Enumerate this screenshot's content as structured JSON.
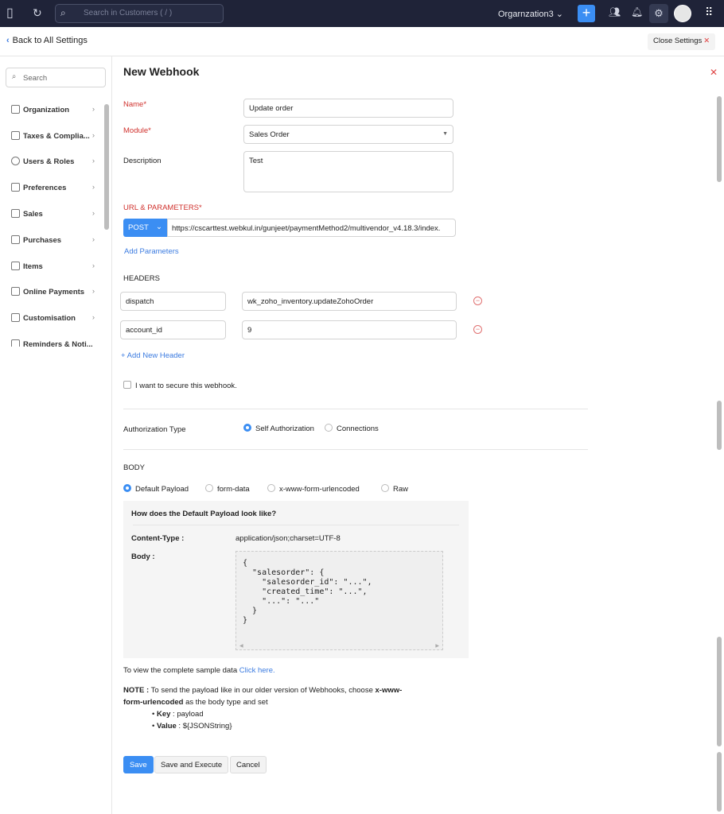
{
  "topbar": {
    "search_placeholder": "Search in Customers ( / )",
    "org": "Orgarnzation3"
  },
  "subheader": {
    "back": "Back to All Settings",
    "close": "Close Settings"
  },
  "sidebar": {
    "search_placeholder": "Search",
    "items": [
      {
        "label": "Organization"
      },
      {
        "label": "Taxes & Complia..."
      },
      {
        "label": "Users & Roles"
      },
      {
        "label": "Preferences"
      },
      {
        "label": "Sales"
      },
      {
        "label": "Purchases"
      },
      {
        "label": "Items"
      },
      {
        "label": "Online Payments"
      },
      {
        "label": "Customisation"
      },
      {
        "label": "Reminders & Noti..."
      }
    ]
  },
  "form": {
    "title": "New Webhook",
    "name_label": "Name*",
    "name_value": "Update order",
    "module_label": "Module*",
    "module_value": "Sales Order",
    "description_label": "Description",
    "description_value": "Test",
    "url_label": "URL & PARAMETERS*",
    "method": "POST",
    "url": "https://cscarttest.webkul.in/gunjeet/paymentMethod2/multivendor_v4.18.3/index.",
    "add_params": "Add Parameters",
    "headers_label": "HEADERS",
    "headers": [
      {
        "key": "dispatch",
        "value": "wk_zoho_inventory.updateZohoOrder"
      },
      {
        "key": "account_id",
        "value": "9"
      }
    ],
    "add_header": "+ Add New Header",
    "secure_label": "I want to secure this webhook.",
    "secure_checked": false,
    "auth_label": "Authorization Type",
    "auth_options": [
      "Self Authorization",
      "Connections"
    ],
    "auth_selected": "Self Authorization",
    "body_label": "BODY",
    "body_options": [
      "Default Payload",
      "form-data",
      "x-www-form-urlencoded",
      "Raw"
    ],
    "body_selected": "Default Payload",
    "payload_title": "How does the Default Payload look like?",
    "content_type_label": "Content-Type :",
    "content_type": "application/json;charset=UTF-8",
    "body_key": "Body :",
    "body_json": "{\n  \"salesorder\": {\n    \"salesorder_id\": \"...\",\n    \"created_time\": \"...\",\n    \"...\": \"...\"\n  }\n}",
    "sample_text": "To view the complete sample data",
    "sample_link": "Click here.",
    "note_label": "NOTE :",
    "note_text1": " To send the payload like in our older version of Webhooks, choose ",
    "note_bold": "x-www-form-urlencoded",
    "note_text2": " as the body type and set",
    "bullets": [
      {
        "key": "Key",
        "value": " : payload"
      },
      {
        "key": "Value",
        "value": " : ${JSONString}"
      }
    ],
    "save": "Save",
    "save_execute": "Save and Execute",
    "cancel": "Cancel"
  },
  "colors": {
    "topbar": "#1f2338",
    "accent": "#3b8ef3",
    "required": "#d0312d"
  }
}
